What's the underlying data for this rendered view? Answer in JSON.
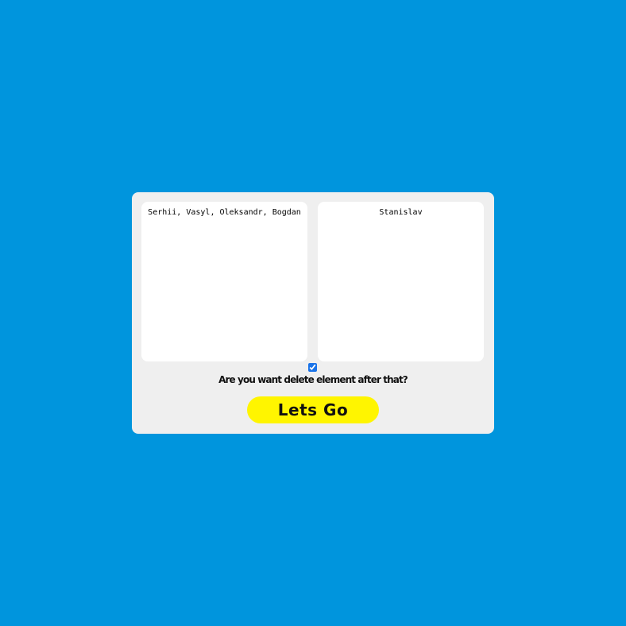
{
  "form": {
    "left_textarea_value": "Serhii, Vasyl, Oleksandr, Bogdan",
    "right_textarea_value": "Stanislav",
    "delete_checkbox_checked": true,
    "delete_question": "Are you want delete element after that?",
    "submit_label": "Lets Go"
  },
  "colors": {
    "background": "#0095dd",
    "card": "#efefef",
    "button": "#fff500"
  }
}
